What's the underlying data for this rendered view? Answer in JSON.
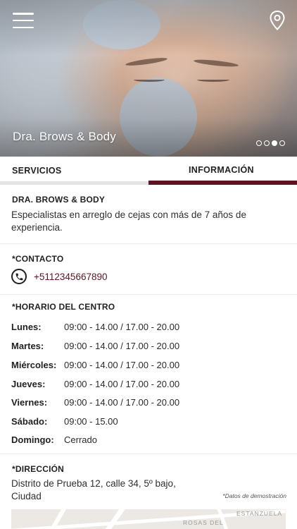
{
  "hero": {
    "title": "Dra. Brows & Body",
    "slides_total": 4,
    "slide_active_index": 2
  },
  "header": {
    "menu_icon": "hamburger-menu-icon",
    "location_icon": "map-pin-icon"
  },
  "tabs": [
    {
      "label": "SERVICIOS",
      "active": false
    },
    {
      "label": "INFORMACIÓN",
      "active": true
    }
  ],
  "about": {
    "title": "DRA. BROWS & BODY",
    "description": "Especialistas en arreglo de cejas con más de 7 años de experiencia."
  },
  "contact": {
    "title": "*CONTACTO",
    "phone": "+5112345667890",
    "icon": "phone-icon"
  },
  "hours": {
    "title": "*HORARIO DEL CENTRO",
    "rows": [
      {
        "day": "Lunes:",
        "time": "09:00 - 14.00  /  17.00 - 20.00"
      },
      {
        "day": "Martes:",
        "time": "09:00 - 14.00  /  17.00 - 20.00"
      },
      {
        "day": "Miércoles:",
        "time": "09:00 - 14.00  /  17.00 - 20.00"
      },
      {
        "day": "Jueves:",
        "time": "09:00 - 14.00  /  17.00 - 20.00"
      },
      {
        "day": "Viernes:",
        "time": "09:00 - 14.00  /  17.00 - 20.00"
      },
      {
        "day": "Sábado:",
        "time": "09:00 - 15.00"
      },
      {
        "day": "Domingo:",
        "time": "Cerrado"
      }
    ]
  },
  "address": {
    "title": "*DIRECCIÓN",
    "text": "Distrito de Prueba 12, calle 34, 5º bajo, Ciudad",
    "demo_note": "*Datos de demostración",
    "map_labels": [
      "ROSAS DEL",
      "ESTANZUELA"
    ]
  },
  "colors": {
    "accent": "#5a1522",
    "tab_inactive_bar": "#e4e4e4"
  }
}
